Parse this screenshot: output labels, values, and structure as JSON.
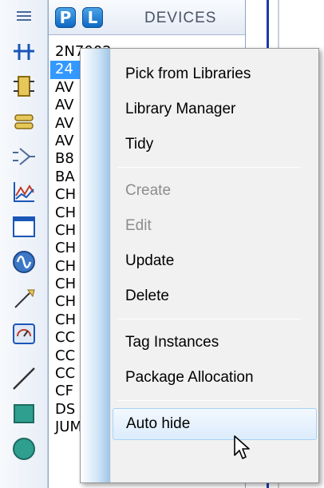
{
  "toolbar": {
    "tools": [
      {
        "icon": "selection-mode-icon"
      },
      {
        "icon": "junction-icon"
      },
      {
        "icon": "component-mode-icon"
      },
      {
        "icon": "label-icon"
      },
      {
        "icon": "terminal-icon"
      },
      {
        "icon": "graph-icon"
      },
      {
        "icon": "window-icon"
      },
      {
        "icon": "generator-icon"
      },
      {
        "icon": "probe-icon"
      },
      {
        "icon": "virtual-instrument-icon"
      },
      {
        "icon": "line-icon"
      },
      {
        "icon": "box-icon"
      },
      {
        "icon": "circle-icon"
      }
    ]
  },
  "panel": {
    "pick_button_label": "P",
    "library_button_label": "L",
    "title": "DEVICES",
    "devices": [
      "2N7002",
      "24",
      "AV",
      "AV",
      "AV",
      "AV",
      "B8",
      "BA",
      "CH",
      "CH",
      "CH",
      "CH",
      "CH",
      "CH",
      "CH",
      "CH",
      "CC",
      "CC",
      "CC",
      "CF",
      "DS",
      "JUMPER"
    ],
    "selected_index": 1
  },
  "context_menu": {
    "items": [
      {
        "label": "Pick from Libraries",
        "enabled": true
      },
      {
        "label": "Library Manager",
        "enabled": true
      },
      {
        "label": "Tidy",
        "enabled": true
      },
      {
        "label": "Create",
        "enabled": false
      },
      {
        "label": "Edit",
        "enabled": false
      },
      {
        "label": "Update",
        "enabled": true
      },
      {
        "label": "Delete",
        "enabled": true
      },
      {
        "label": "Tag Instances",
        "enabled": true
      },
      {
        "label": "Package Allocation",
        "enabled": true
      },
      {
        "label": "Auto hide",
        "enabled": true,
        "highlighted": true
      }
    ]
  },
  "colors": {
    "selection": "#3399ff",
    "header_button": "#1a7ad4",
    "menu_highlight_border": "#a8d2f7",
    "canvas_line": "#1b3aa8"
  }
}
